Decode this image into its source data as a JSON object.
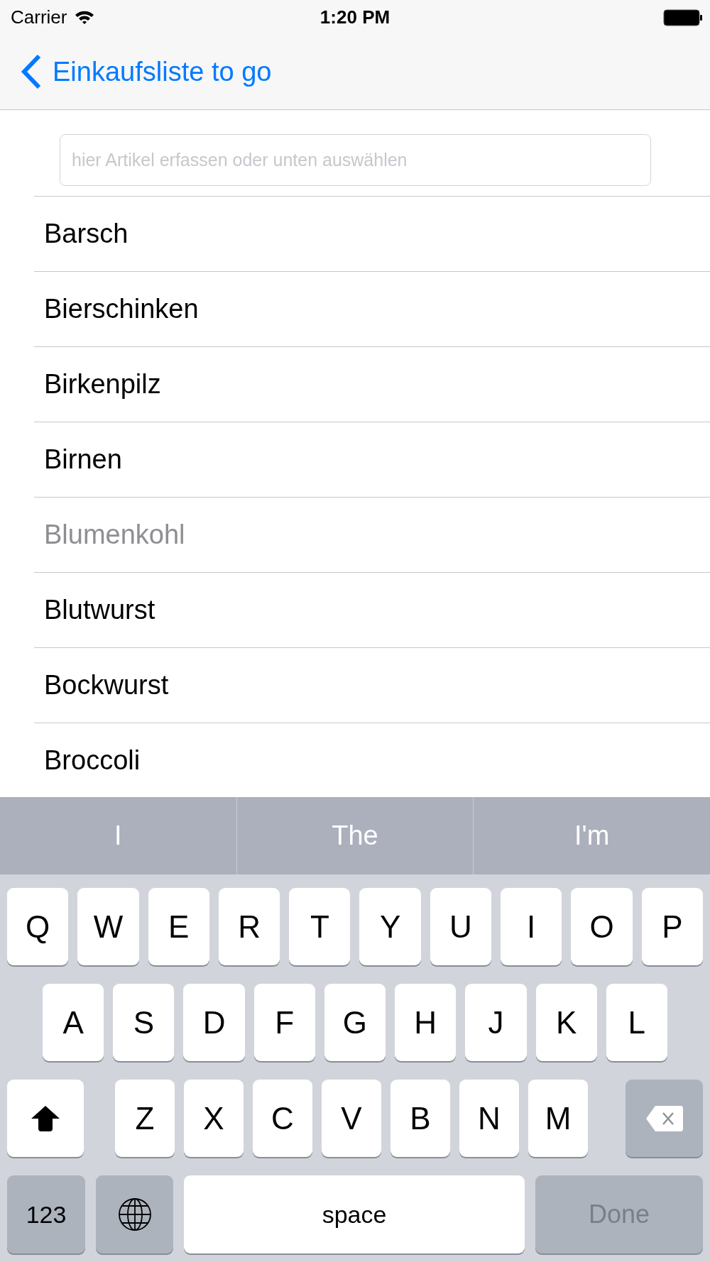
{
  "status_bar": {
    "carrier": "Carrier",
    "time": "1:20 PM"
  },
  "nav": {
    "back_label": "Einkaufsliste to go"
  },
  "search": {
    "placeholder": "hier Artikel erfassen oder unten auswählen"
  },
  "items": [
    {
      "label": "Barsch",
      "dimmed": false
    },
    {
      "label": "Bierschinken",
      "dimmed": false
    },
    {
      "label": "Birkenpilz",
      "dimmed": false
    },
    {
      "label": "Birnen",
      "dimmed": false
    },
    {
      "label": "Blumenkohl",
      "dimmed": true
    },
    {
      "label": "Blutwurst",
      "dimmed": false
    },
    {
      "label": "Bockwurst",
      "dimmed": false
    },
    {
      "label": "Broccoli",
      "dimmed": false
    }
  ],
  "suggestions": [
    "I",
    "The",
    "I'm"
  ],
  "keyboard": {
    "rows": [
      [
        {
          "kind": "letter",
          "label": "Q"
        },
        {
          "kind": "letter",
          "label": "W"
        },
        {
          "kind": "letter",
          "label": "E"
        },
        {
          "kind": "letter",
          "label": "R"
        },
        {
          "kind": "letter",
          "label": "T"
        },
        {
          "kind": "letter",
          "label": "Y"
        },
        {
          "kind": "letter",
          "label": "U"
        },
        {
          "kind": "letter",
          "label": "I"
        },
        {
          "kind": "letter",
          "label": "O"
        },
        {
          "kind": "letter",
          "label": "P"
        }
      ],
      [
        {
          "kind": "letter",
          "label": "A"
        },
        {
          "kind": "letter",
          "label": "S"
        },
        {
          "kind": "letter",
          "label": "D"
        },
        {
          "kind": "letter",
          "label": "F"
        },
        {
          "kind": "letter",
          "label": "G"
        },
        {
          "kind": "letter",
          "label": "H"
        },
        {
          "kind": "letter",
          "label": "J"
        },
        {
          "kind": "letter",
          "label": "K"
        },
        {
          "kind": "letter",
          "label": "L"
        }
      ],
      [
        {
          "kind": "shift"
        },
        {
          "kind": "letter",
          "label": "Z"
        },
        {
          "kind": "letter",
          "label": "X"
        },
        {
          "kind": "letter",
          "label": "C"
        },
        {
          "kind": "letter",
          "label": "V"
        },
        {
          "kind": "letter",
          "label": "B"
        },
        {
          "kind": "letter",
          "label": "N"
        },
        {
          "kind": "letter",
          "label": "M"
        },
        {
          "kind": "delete"
        }
      ]
    ],
    "bottom_row": [
      {
        "kind": "numbers",
        "label": "123"
      },
      {
        "kind": "globe"
      },
      {
        "kind": "space",
        "label": "space"
      },
      {
        "kind": "done",
        "label": "Done",
        "disabled": true
      }
    ]
  }
}
